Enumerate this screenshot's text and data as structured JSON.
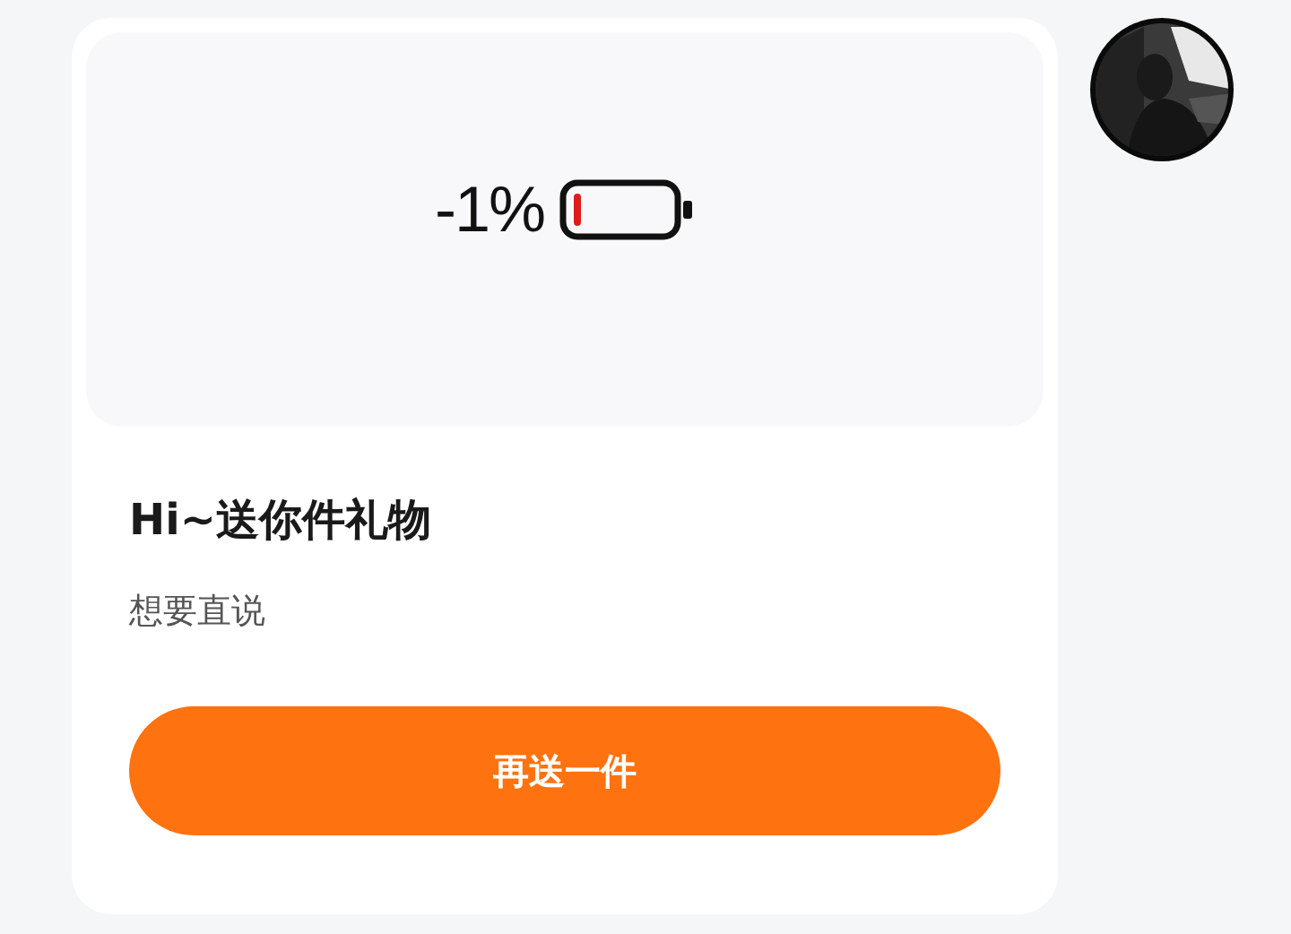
{
  "gift_card": {
    "image": {
      "percent_text": "-1%"
    },
    "title": "Hi~送你件礼物",
    "subtitle": "想要直说",
    "button": "再送一件"
  }
}
